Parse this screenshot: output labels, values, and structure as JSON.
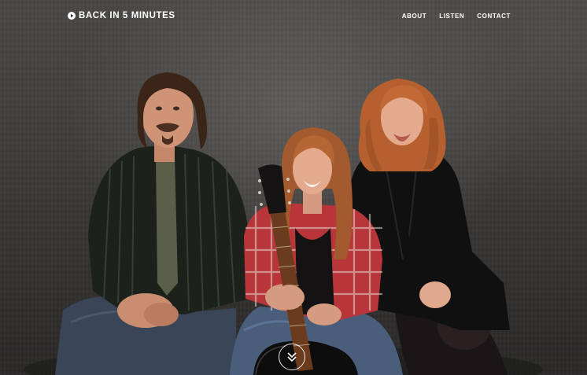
{
  "header": {
    "brand_label": "BACK IN 5 MINUTES",
    "brand_icon": "play-circle-icon",
    "nav": [
      {
        "label": "ABOUT"
      },
      {
        "label": "LISTEN"
      },
      {
        "label": "CONTACT"
      }
    ]
  },
  "hero": {
    "image": "band-photo",
    "scroll_icon": "double-chevron-down-icon"
  },
  "colors": {
    "text": "#ffffff",
    "background": "#3e3c3a"
  }
}
